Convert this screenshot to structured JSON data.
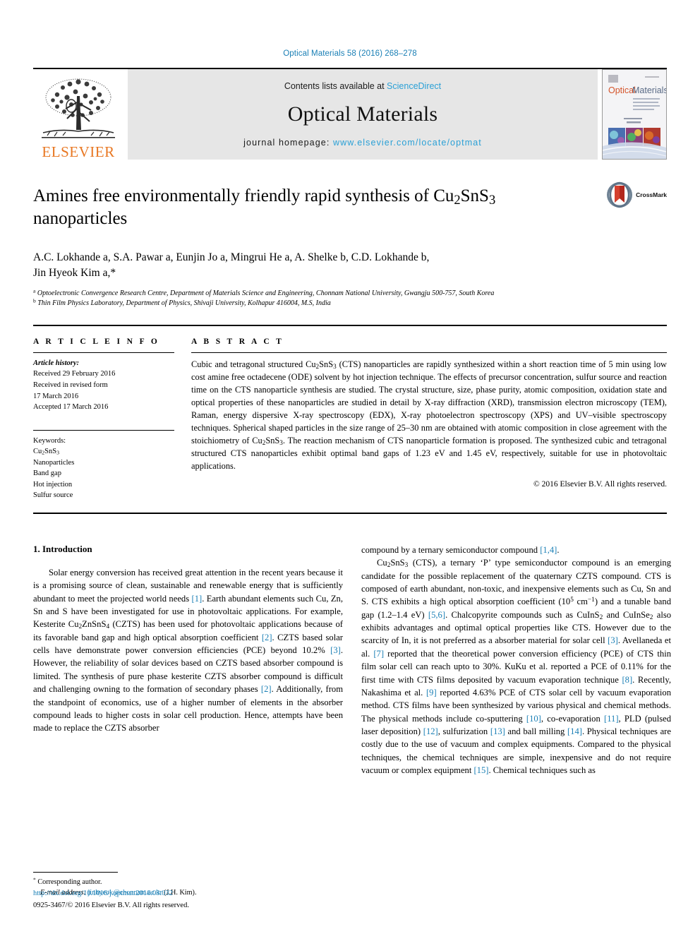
{
  "running_head": "Optical Materials 58 (2016) 268–278",
  "masthead": {
    "publisher_name": "ELSEVIER",
    "contents_prefix": "Contents lists available at ",
    "contents_link": "ScienceDirect",
    "journal_title": "Optical Materials",
    "homepage_prefix": "journal homepage: ",
    "homepage_url": "www.elsevier.com/locate/optmat",
    "cover_title_word1": "Optical",
    "cover_title_word2": "Materials"
  },
  "article": {
    "title_line1": "Amines free environmentally friendly rapid synthesis of Cu",
    "title_sub1": "2",
    "title_mid": "SnS",
    "title_sub2": "3",
    "title_line2": "nanoparticles",
    "crossmark_label": "CrossMark",
    "authors_line1": "A.C. Lokhande a, S.A. Pawar a, Eunjin Jo a, Mingrui He a, A. Shelke b, C.D. Lokhande b,",
    "authors_line2": "Jin Hyeok Kim a,*",
    "affiliation_a": "Optoelectronic Convergence Research Centre, Department of Materials Science and Engineering, Chonnam National University, Gwangju 500-757, South Korea",
    "affiliation_b": "Thin Film Physics Laboratory, Department of Physics, Shivaji University, Kolhapur 416004, M.S, India"
  },
  "article_info": {
    "heading": "A R T I C L E  I N F O",
    "history_label": "Article history:",
    "history_lines": [
      "Received 29 February 2016",
      "Received in revised form",
      "17 March 2016",
      "Accepted 17 March 2016"
    ],
    "keywords_label": "Keywords:",
    "keywords": [
      "Cu2SnS3",
      "Nanoparticles",
      "Band gap",
      "Hot injection",
      "Sulfur source"
    ]
  },
  "abstract": {
    "heading": "A B S T R A C T",
    "text": "Cubic and tetragonal structured Cu2SnS3 (CTS) nanoparticles are rapidly synthesized within a short reaction time of 5 min using low cost amine free octadecene (ODE) solvent by hot injection technique. The effects of precursor concentration, sulfur source and reaction time on the CTS nanoparticle synthesis are studied. The crystal structure, size, phase purity, atomic composition, oxidation state and optical properties of these nanoparticles are studied in detail by X-ray diffraction (XRD), transmission electron microscopy (TEM), Raman, energy dispersive X-ray spectroscopy (EDX), X-ray photoelectron spectroscopy (XPS) and UV–visible spectroscopy techniques. Spherical shaped particles in the size range of 25–30 nm are obtained with atomic composition in close agreement with the stoichiometry of Cu2SnS3. The reaction mechanism of CTS nanoparticle formation is proposed. The synthesized cubic and tetragonal structured CTS nanoparticles exhibit optimal band gaps of 1.23 eV and 1.45 eV, respectively, suitable for use in photovoltaic applications.",
    "copyright": "© 2016 Elsevier B.V. All rights reserved."
  },
  "body": {
    "section_number_title": "1. Introduction",
    "left_paragraph": "Solar energy conversion has received great attention in the recent years because it is a promising source of clean, sustainable and renewable energy that is sufficiently abundant to meet the projected world needs [1]. Earth abundant elements such Cu, Zn, Sn and S have been investigated for use in photovoltaic applications. For example, Kesterite Cu2ZnSnS4 (CZTS) has been used for photovoltaic applications because of its favorable band gap and high optical absorption coefficient [2]. CZTS based solar cells have demonstrate power conversion efficiencies (PCE) beyond 10.2% [3]. However, the reliability of solar devices based on CZTS based absorber compound is limited. The synthesis of pure phase kesterite CZTS absorber compound is difficult and challenging owning to the formation of secondary phases [2]. Additionally, from the standpoint of economics, use of a higher number of elements in the absorber compound leads to higher costs in solar cell production. Hence, attempts have been made to replace the CZTS absorber",
    "right_paragraph_1": "compound by a ternary semiconductor compound [1,4].",
    "right_paragraph_2": "Cu2SnS3 (CTS), a ternary 'P' type semiconductor compound is an emerging candidate for the possible replacement of the quaternary CZTS compound. CTS is composed of earth abundant, non-toxic, and inexpensive elements such as Cu, Sn and S. CTS exhibits a high optical absorption coefficient (105 cm−1) and a tunable band gap (1.2–1.4 eV) [5,6]. Chalcopyrite compounds such as CuInS2 and CuInSe2 also exhibits advantages and optimal optical properties like CTS. However due to the scarcity of In, it is not preferred as a absorber material for solar cell [3]. Avellaneda et al. [7] reported that the theoretical power conversion efficiency (PCE) of CTS thin film solar cell can reach upto to 30%. KuKu et al. reported a PCE of 0.11% for the first time with CTS films deposited by vacuum evaporation technique [8]. Recently, Nakashima et al. [9] reported 4.63% PCE of CTS solar cell by vacuum evaporation method. CTS films have been synthesized by various physical and chemical methods. The physical methods include co-sputtering [10], co-evaporation [11], PLD (pulsed laser deposition) [12], sulfurization [13] and ball milling [14]. Physical techniques are costly due to the use of vacuum and complex equipments. Compared to the physical techniques, the chemical techniques are simple, inexpensive and do not require vacuum or complex equipment [15]. Chemical techniques such as"
  },
  "footnote": {
    "star": "*",
    "corresponding": "Corresponding author.",
    "email_label": "E-mail address:",
    "email": "jinhyeok@chonnam.ac.kr",
    "email_suffix": "(J.H. Kim)."
  },
  "page_footer": {
    "doi": "http://dx.doi.org/10.1016/j.optmat.2016.03.032",
    "issn_copyright": "0925-3467/© 2016 Elsevier B.V. All rights reserved."
  },
  "colors": {
    "link_blue": "#1a7fb5",
    "sciencedirect_blue": "#2aa0d6",
    "elsevier_orange": "#E87722",
    "banner_gray": "#e6e6e6"
  }
}
